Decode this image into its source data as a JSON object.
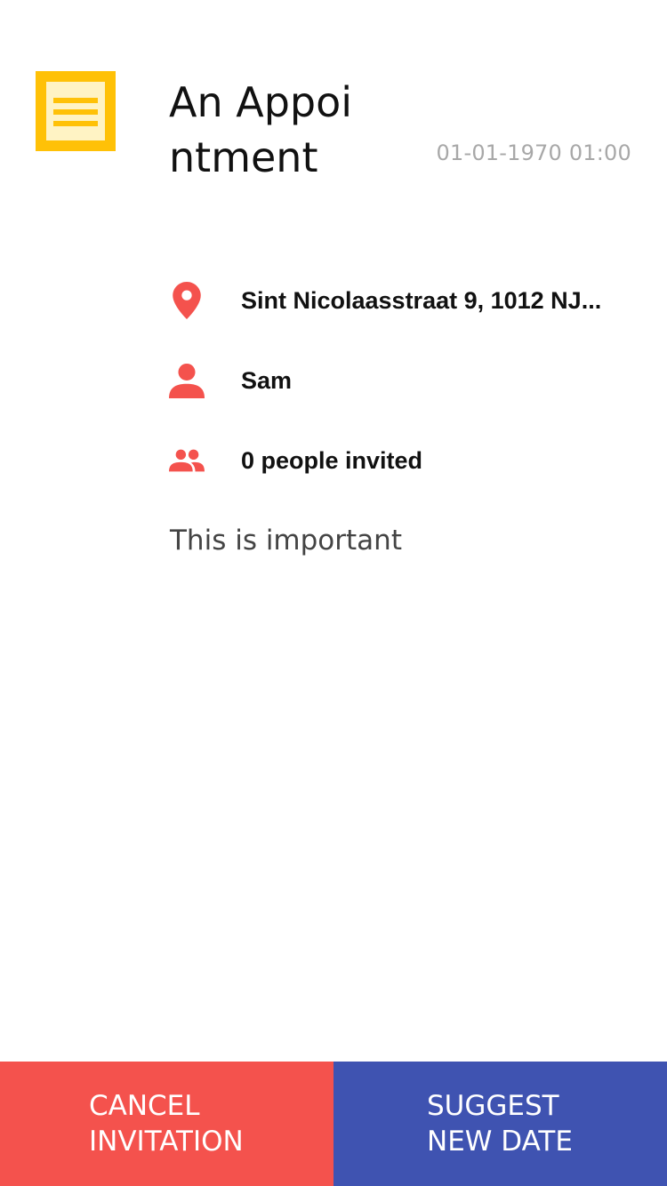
{
  "appointment": {
    "title": "An Appointment",
    "datetime": "01-01-1970 01:00",
    "category_icon": "note-icon",
    "location": "Sint Nicolaasstraat 9, 1012 NJ...",
    "organizer": "Sam",
    "invited": "0 people invited",
    "description": "This is important"
  },
  "icons": {
    "location": "location-pin-icon",
    "organizer": "person-icon",
    "invited": "people-icon"
  },
  "actions": {
    "cancel_label": "CANCEL\nINVITATION",
    "suggest_label": "SUGGEST\nNEW DATE"
  },
  "colors": {
    "accent_red": "#F4524D",
    "accent_blue": "#3F53B1",
    "note_yellow": "#FFC107",
    "datetime_gray": "#a8a8a8"
  }
}
